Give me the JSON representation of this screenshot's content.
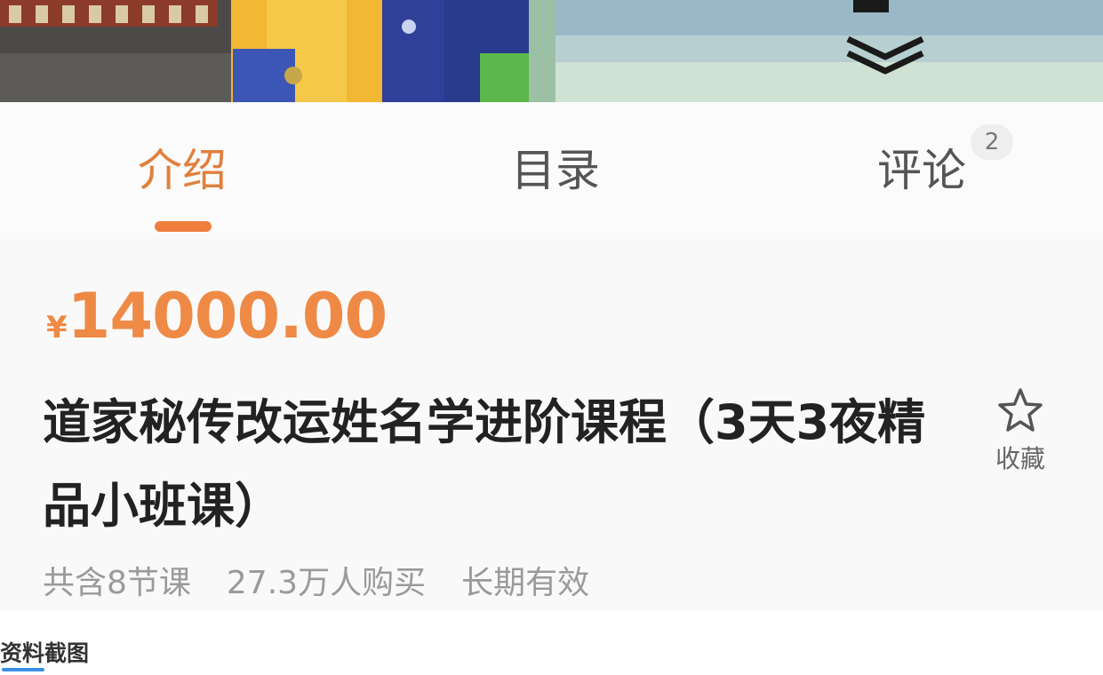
{
  "tabs": [
    {
      "label": "介绍",
      "active": true
    },
    {
      "label": "目录",
      "active": false
    },
    {
      "label": "评论",
      "active": false,
      "badge": "2"
    }
  ],
  "course": {
    "currency": "¥",
    "price": "14000.00",
    "title": "道家秘传改运姓名学进阶课程（3天3夜精品小班课）",
    "favorite_label": "收藏",
    "lesson_count": "共含8节课",
    "buyers": "27.3万人购买",
    "validity": "长期有效"
  },
  "caption": "资料截图",
  "colors": {
    "accent": "#ef7e3e",
    "price": "#ee8a45",
    "title": "#222222",
    "meta": "#9a9a9a"
  },
  "icons": [
    "expand-chevron-icon",
    "star-outline-icon"
  ]
}
